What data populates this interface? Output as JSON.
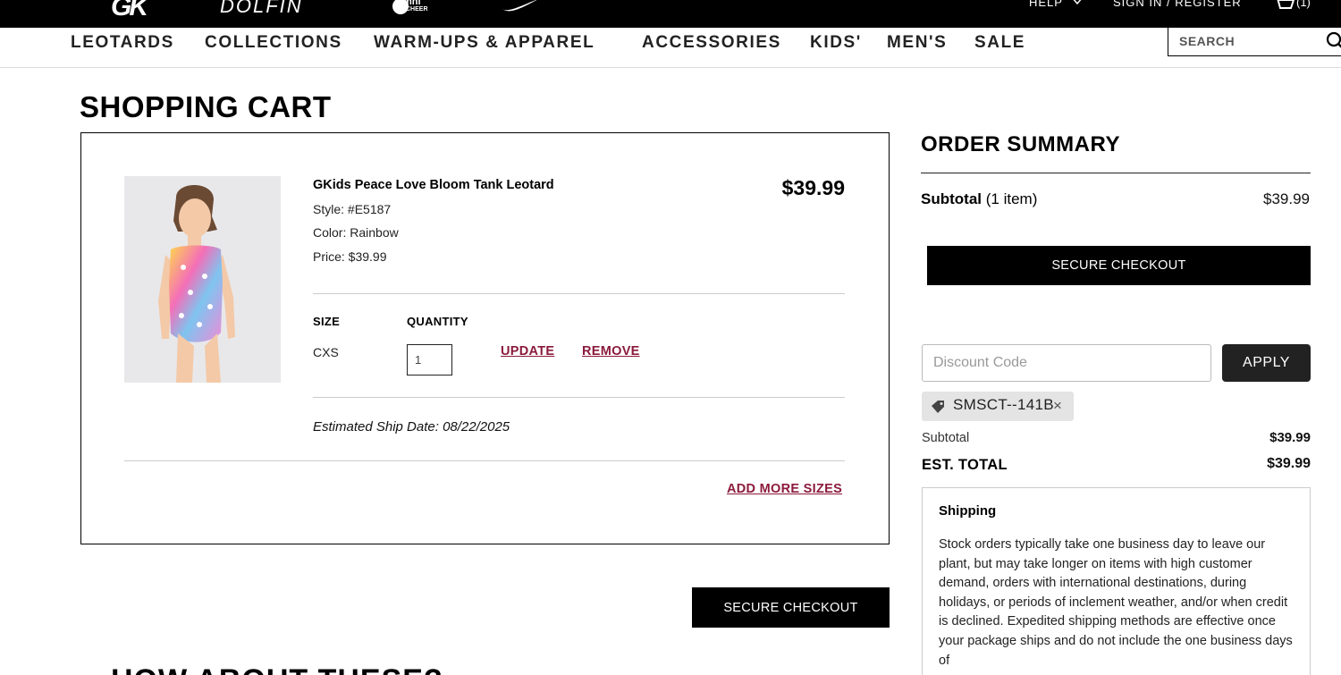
{
  "topbar": {
    "brands": [
      "GK",
      "DOLFIN",
      "omni CHEER",
      "Nike"
    ],
    "help": "HELP",
    "signin": "SIGN IN / REGISTER",
    "cart_count": "(1)"
  },
  "nav": {
    "items": [
      "LEOTARDS",
      "COLLECTIONS",
      "WARM-UPS & APPAREL",
      "ACCESSORIES",
      "KIDS'",
      "MEN'S",
      "SALE"
    ],
    "search_placeholder": "SEARCH"
  },
  "page_title": "SHOPPING CART",
  "cart": {
    "item": {
      "name": "GKids Peace Love Bloom Tank Leotard",
      "style": "Style: #E5187",
      "color": "Color: Rainbow",
      "price_line": "Price: $39.99",
      "price": "$39.99",
      "size_header": "SIZE",
      "quantity_header": "QUANTITY",
      "size": "CXS",
      "quantity": "1",
      "update": "UPDATE",
      "remove": "REMOVE",
      "ship_date": "Estimated Ship Date: 08/22/2025",
      "add_more": "ADD MORE SIZES"
    },
    "checkout": "SECURE CHECKOUT"
  },
  "how_about": "HOW ABOUT THESE?",
  "summary": {
    "title": "ORDER SUMMARY",
    "subtotal_label": "Subtotal",
    "subtotal_count": "(1 item)",
    "subtotal_value": "$39.99",
    "checkout": "SECURE CHECKOUT",
    "discount_placeholder": "Discount Code",
    "apply": "APPLY",
    "coupon_code": "SMSCT--141B",
    "coupon_remove": "×",
    "totals_subtotal_label": "Subtotal",
    "totals_subtotal_value": "$39.99",
    "est_total_label": "EST. TOTAL",
    "est_total_value": "$39.99",
    "shipping_title": "Shipping",
    "shipping_text": "Stock orders typically take one business day to leave our plant, but may take longer on items with high customer demand, orders with international destinations, during holidays, or periods of inclement weather, and/or when credit is declined. Expedited shipping methods are effective once your package ships and do not include the one business days of"
  }
}
